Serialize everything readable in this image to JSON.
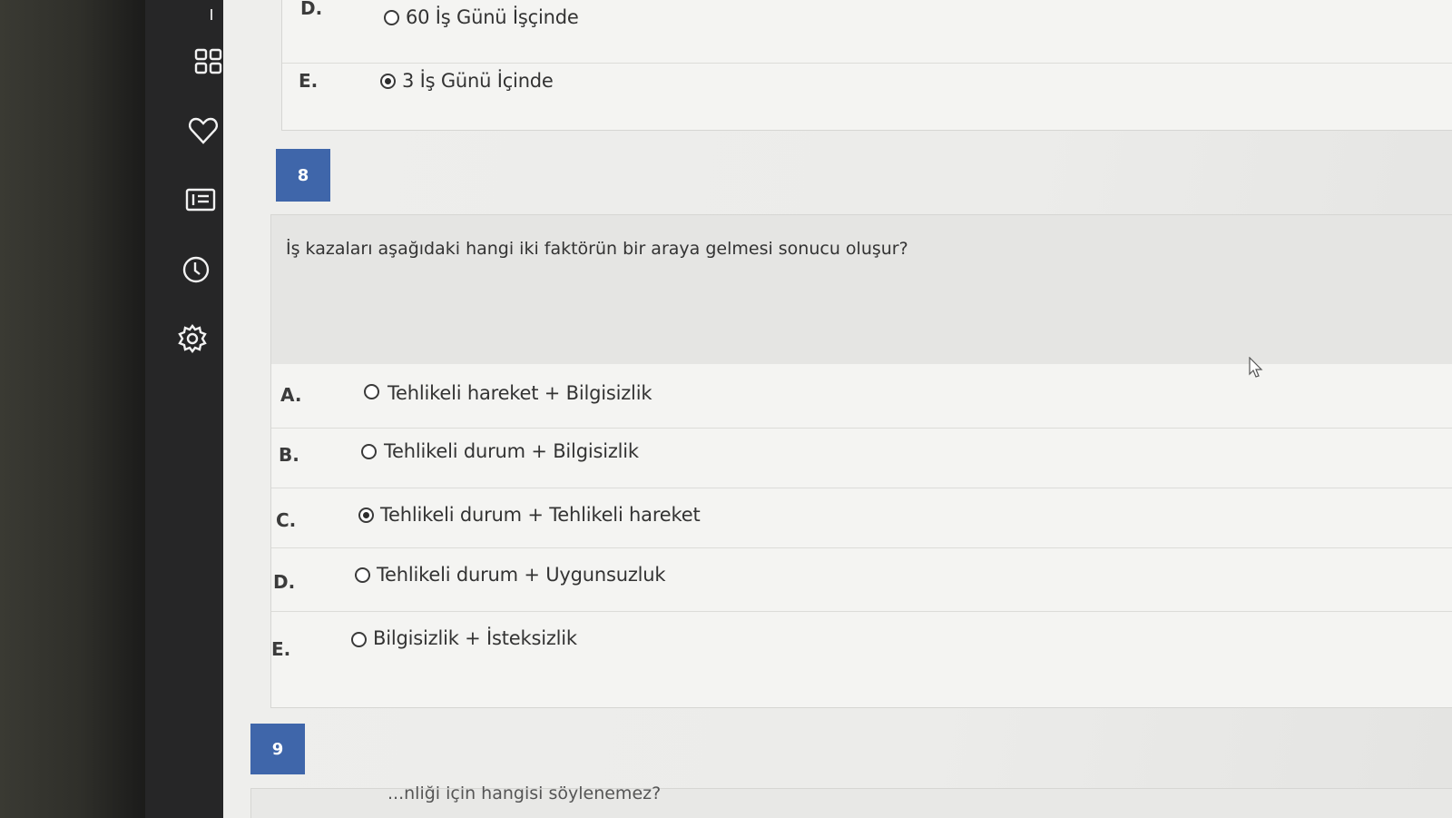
{
  "prev_question": {
    "options": [
      {
        "letter": "D.",
        "label": "60 İş Günü İşçinde",
        "selected": false
      },
      {
        "letter": "E.",
        "label": "3 İş Günü İçinde",
        "selected": true
      }
    ]
  },
  "question8": {
    "number": "8",
    "text": "İş kazaları aşağıdaki hangi iki faktörün bir araya gelmesi sonucu oluşur?",
    "options": [
      {
        "letter": "A.",
        "label": "Tehlikeli hareket + Bilgisizlik",
        "selected": false
      },
      {
        "letter": "B.",
        "label": "Tehlikeli durum + Bilgisizlik",
        "selected": false
      },
      {
        "letter": "C.",
        "label": "Tehlikeli durum + Tehlikeli hareket",
        "selected": true
      },
      {
        "letter": "D.",
        "label": "Tehlikeli durum + Uygunsuzluk",
        "selected": false
      },
      {
        "letter": "E.",
        "label": "Bilgisizlik + İsteksizlik",
        "selected": false
      }
    ]
  },
  "question9": {
    "number": "9",
    "text_partial": "...nliği için hangisi söylenemez?"
  },
  "sidebar": {
    "icons": [
      "grid-icon",
      "heart-icon",
      "list-icon",
      "clock-icon",
      "gear-icon"
    ]
  },
  "colors": {
    "accent": "#3f66aa",
    "sidebar": "#262627",
    "page": "#eeeeec"
  }
}
